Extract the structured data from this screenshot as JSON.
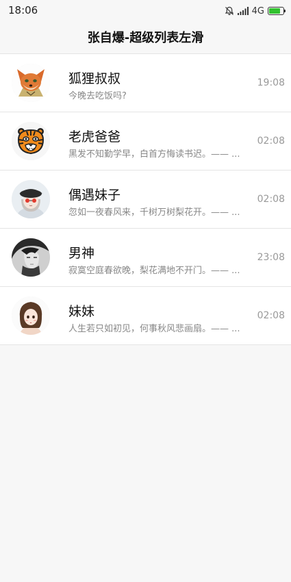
{
  "status_bar": {
    "time": "18:06",
    "network": "4G",
    "battery_level": 0.8,
    "battery_color": "#32c22f"
  },
  "title_bar": {
    "title": "张自爆-超级列表左滑"
  },
  "conversations": [
    {
      "name": "狐狸叔叔",
      "message": "今晚去吃饭吗?",
      "time": "19:08",
      "avatar": "fox-avatar"
    },
    {
      "name": "老虎爸爸",
      "message": "黑发不知勤学早，白首方悔读书迟。—— ...",
      "time": "02:08",
      "avatar": "tiger-avatar"
    },
    {
      "name": "偶遇妹子",
      "message": "忽如一夜春风来，千树万树梨花开。—— ...",
      "time": "02:08",
      "avatar": "girl-avatar"
    },
    {
      "name": "男神",
      "message": "寂寞空庭春欲晚，梨花满地不开门。—— ...",
      "time": "23:08",
      "avatar": "man-avatar"
    },
    {
      "name": "妹妹",
      "message": "人生若只如初见，何事秋风悲画扇。—— ...",
      "time": "02:08",
      "avatar": "sister-avatar"
    }
  ]
}
